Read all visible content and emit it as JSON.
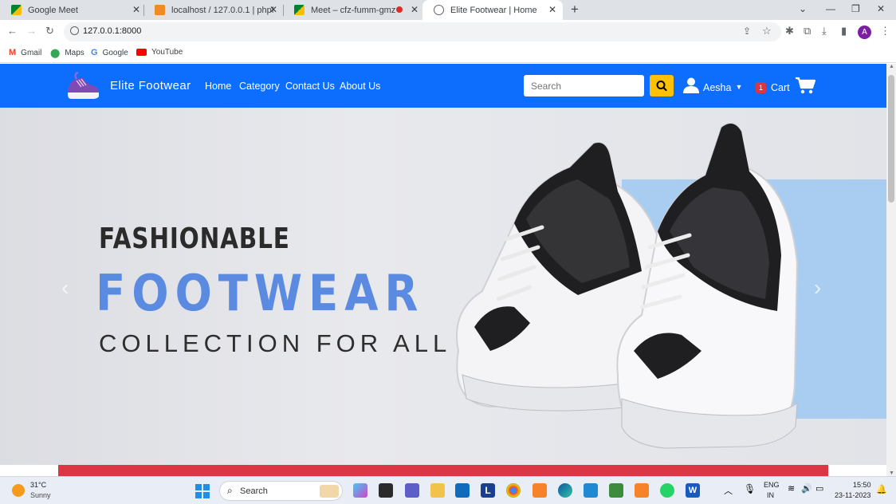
{
  "browser": {
    "tabs": [
      {
        "title": "Google Meet",
        "active": false
      },
      {
        "title": "localhost / 127.0.0.1 | phpMyAdmin",
        "active": false
      },
      {
        "title": "Meet – cfz-fumm-gmz",
        "active": false
      },
      {
        "title": "Elite Footwear | Home",
        "active": true
      }
    ],
    "url": "127.0.0.1:8000",
    "profile_initial": "A",
    "bookmarks": [
      {
        "label": "Gmail",
        "icon": "gmail-icon"
      },
      {
        "label": "Maps",
        "icon": "maps-icon"
      },
      {
        "label": "Google",
        "icon": "google-icon"
      },
      {
        "label": "YouTube",
        "icon": "youtube-icon"
      }
    ]
  },
  "site": {
    "brand": "Elite Footwear",
    "nav": [
      "Home",
      "Category",
      "Contact Us",
      "About Us"
    ],
    "search_placeholder": "Search",
    "user_name": "Aesha",
    "cart_label": "Cart",
    "cart_count": "1",
    "colors": {
      "navbar": "#0d6efd",
      "search_button": "#ffc107",
      "badge": "#dc3545"
    }
  },
  "hero": {
    "line1": "FASHIONABLE",
    "line2": "FOOTWEAR",
    "line3": "COLLECTION FOR ALL"
  },
  "taskbar": {
    "weather_temp": "31°C",
    "weather_desc": "Sunny",
    "search_label": "Search",
    "lang": "ENG",
    "region": "IN",
    "time": "15:50",
    "date": "23-11-2023"
  }
}
